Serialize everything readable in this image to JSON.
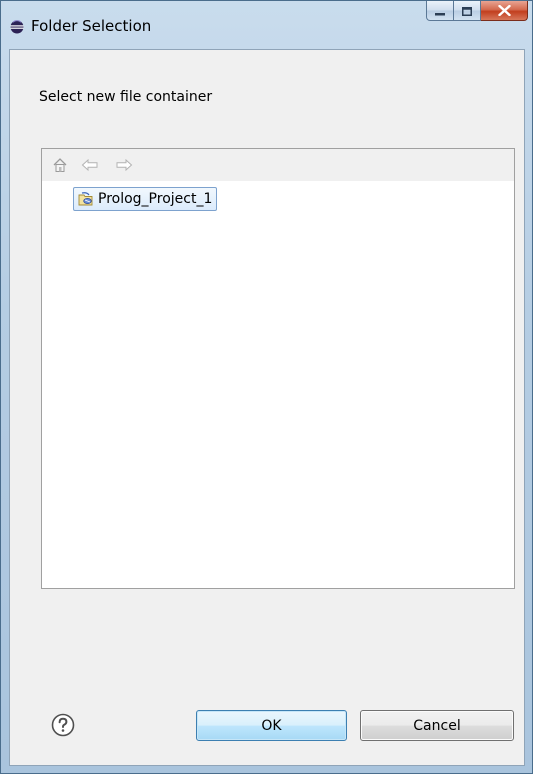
{
  "window": {
    "title": "Folder Selection",
    "title_icon": "eclipse-icon",
    "controls": {
      "minimize": "minimize-icon",
      "maximize": "maximize-icon",
      "close": "close-icon"
    }
  },
  "dialog": {
    "prompt": "Select new file container",
    "toolbar": {
      "home_icon": "home-icon",
      "back_icon": "back-arrow-icon",
      "forward_icon": "forward-arrow-icon"
    },
    "tree": {
      "items": [
        {
          "label": "Prolog_Project_1",
          "icon": "project-icon",
          "selected": true
        }
      ]
    },
    "help_icon": "help-icon",
    "buttons": {
      "ok": "OK",
      "cancel": "Cancel"
    }
  },
  "colors": {
    "title_gradient_top": "#c9dced",
    "client_background": "#f0f0f0",
    "selection_border": "#7da2ce",
    "default_button_border": "#3c7fb1",
    "close_button": "#c23f1f"
  }
}
